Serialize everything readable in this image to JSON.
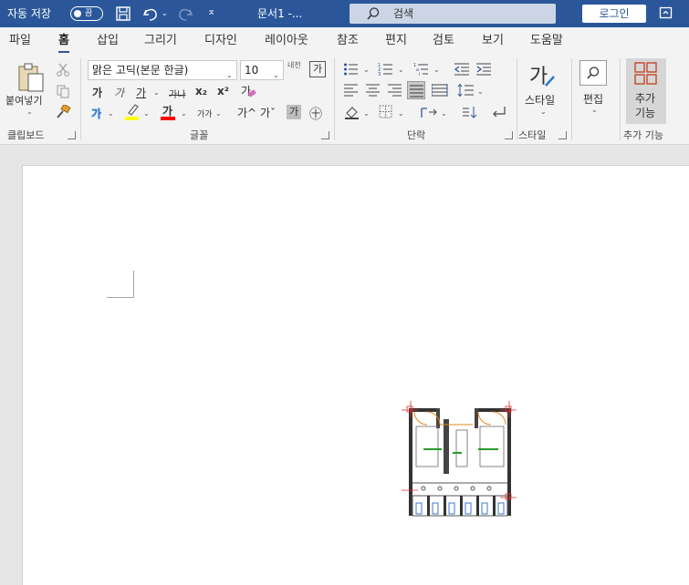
{
  "titlebar": {
    "autosave_label": "자동 저장",
    "autosave_state": "끔",
    "doc_title": "문서1  -...",
    "search_placeholder": "검색",
    "login_label": "로그인"
  },
  "tabs": [
    "파일",
    "홈",
    "삽입",
    "그리기",
    "디자인",
    "레이아웃",
    "참조",
    "편지",
    "검토",
    "보기",
    "도움말"
  ],
  "active_tab": "홈",
  "clipboard": {
    "paste_label": "붙여넣기",
    "group_label": "클립보드"
  },
  "font": {
    "name": "맑은 고딕(본문 한글)",
    "size": "10",
    "phonetic": "내천",
    "char_border_glyph": "가",
    "bold": "가",
    "italic": "가",
    "underline": "가",
    "strike": "가나",
    "subscript": "x₂",
    "superscript": "x²",
    "clear_format": "가",
    "effects": "가",
    "highlight": "가",
    "font_color": "가",
    "case": "가가",
    "grow": "가^",
    "shrink": "가ˇ",
    "shade": "가",
    "enclose": "㊉",
    "group_label": "글꼴"
  },
  "paragraph": {
    "group_label": "단락"
  },
  "styles": {
    "label": "스타일",
    "glyph": "가",
    "group_label": "스타일"
  },
  "editing": {
    "label": "편집"
  },
  "addins": {
    "label": "추가\n기능",
    "group_label": "추가 기능"
  },
  "colors": {
    "brand": "#2b579a",
    "highlight": "#ffff00",
    "font_color": "#ff0000",
    "addin_icon": "#c43e1c"
  }
}
